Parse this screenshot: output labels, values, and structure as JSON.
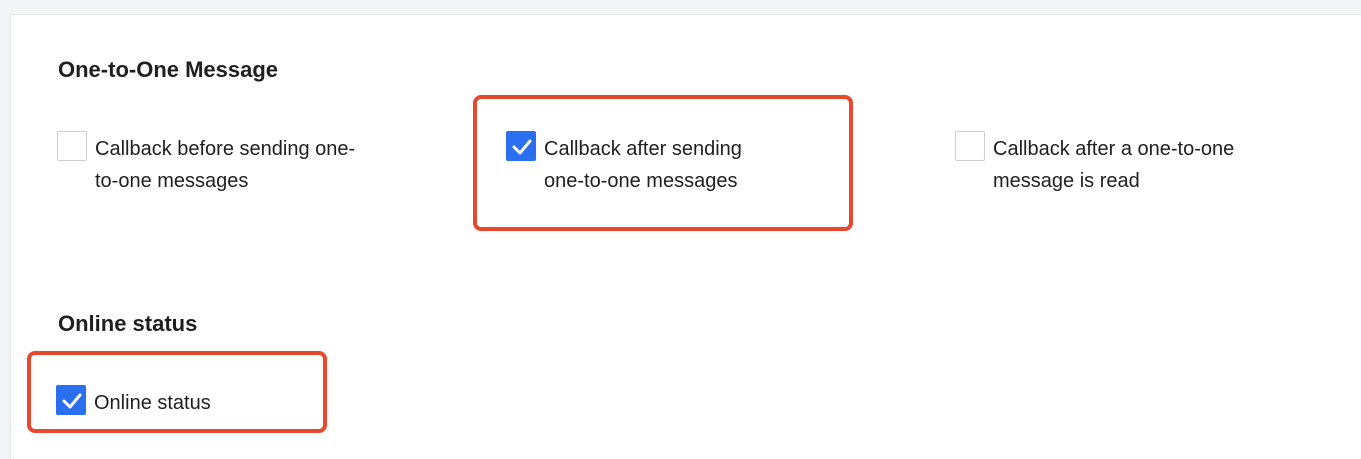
{
  "sections": [
    {
      "title": "One-to-One Message",
      "options": [
        {
          "lines": [
            "Callback before sending one-",
            "to-one messages"
          ],
          "checked": false,
          "highlighted": false
        },
        {
          "lines": [
            "Callback after sending",
            "one-to-one messages"
          ],
          "checked": true,
          "highlighted": true
        },
        {
          "lines": [
            "Callback after a one-to-one",
            "message is read"
          ],
          "checked": false,
          "highlighted": false
        }
      ]
    },
    {
      "title": "Online status",
      "options": [
        {
          "lines": [
            "Online status"
          ],
          "checked": true,
          "highlighted": true
        }
      ]
    }
  ],
  "colors": {
    "accent": "#2a6ff0",
    "highlight": "#e8492e"
  }
}
